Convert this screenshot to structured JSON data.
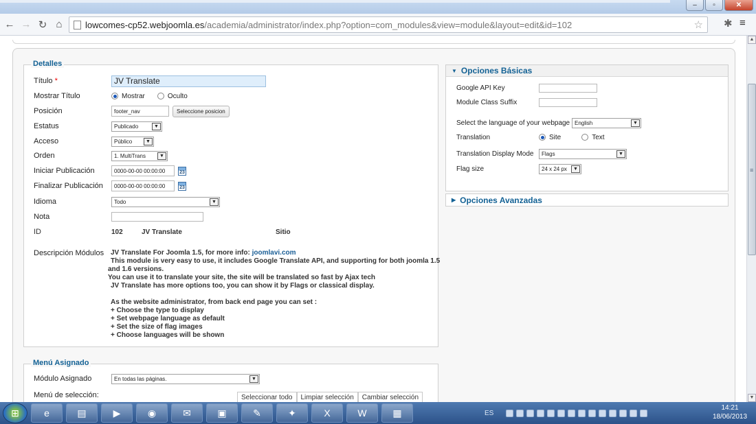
{
  "browser": {
    "url_host": "lowcomes-cp52.webjoomla.es",
    "url_path": "/academia/administrator/index.php?option=com_modules&view=module&layout=edit&id=102"
  },
  "detalles": {
    "legend": "Detalles",
    "titulo_label": "Título",
    "titulo_required": " *",
    "titulo_value": "JV Translate",
    "mostrar_label": "Mostrar Título",
    "mostrar_opt1": "Mostrar",
    "mostrar_opt2": "Oculto",
    "posicion_label": "Posición",
    "posicion_value": "footer_nav",
    "posicion_button": "Seleccione posicion",
    "estatus_label": "Estatus",
    "estatus_value": "Publicado",
    "acceso_label": "Acceso",
    "acceso_value": "Público",
    "orden_label": "Orden",
    "orden_value": "1. MultiTrans",
    "iniciar_label": "Iniciar Publicación",
    "iniciar_value": "0000-00-00 00:00:00",
    "finalizar_label": "Finalizar Publicación",
    "finalizar_value": "0000-00-00 00:00:00",
    "idioma_label": "Idioma",
    "idioma_value": "Todo",
    "nota_label": "Nota",
    "nota_value": "",
    "id_label": "ID",
    "id_value": "102",
    "id_name": "JV Translate",
    "id_site": "Sitio",
    "desc_label": "Descripción Módulos",
    "desc_line1_text": "JV Translate For Joomla 1.5, for more info: ",
    "desc_line1_link": "joomlavi.com",
    "desc_line2": "This module is very easy to use, it includes Google Translate API, and supporting for both joomla 1.5",
    "desc_line3": "and 1.6 versions.",
    "desc_line4": "You can use it to translate your site, the site will be translated so fast by Ajax tech",
    "desc_line5": "JV Translate has more options too, you can show it by Flags or classical display.",
    "desc_line6": "As the website administrator, from back end page you can set :",
    "desc_line7": "+ Choose the type to display",
    "desc_line8": "+ Set webpage language as default",
    "desc_line9": "+ Set the size of flag images",
    "desc_line10": "+ Choose languages will be shown"
  },
  "opciones_basicas": {
    "title": "Opciones Básicas",
    "api_key_label": "Google API Key",
    "suffix_label": "Module Class Suffix",
    "lang_label": "Select the language of your webpage",
    "lang_value": "English",
    "translation_label": "Translation",
    "translation_opt1": "Site",
    "translation_opt2": "Text",
    "display_mode_label": "Translation Display Mode",
    "display_mode_value": "Flags",
    "flag_size_label": "Flag size",
    "flag_size_value": "24 x 24 px"
  },
  "opciones_avanzadas": {
    "title": "Opciones Avanzadas"
  },
  "menu_asignado": {
    "legend": "Menú Asignado",
    "modulo_label": "Módulo Asignado",
    "modulo_value": "En todas las páginas.",
    "seleccion_label": "Menú de selección:",
    "btn_select_all": "Seleccionar todo",
    "btn_clear": "Limpiar selección",
    "btn_toggle": "Cambiar selección"
  },
  "taskbar": {
    "lang": "ES",
    "time": "14:21",
    "date": "18/06/2013"
  }
}
